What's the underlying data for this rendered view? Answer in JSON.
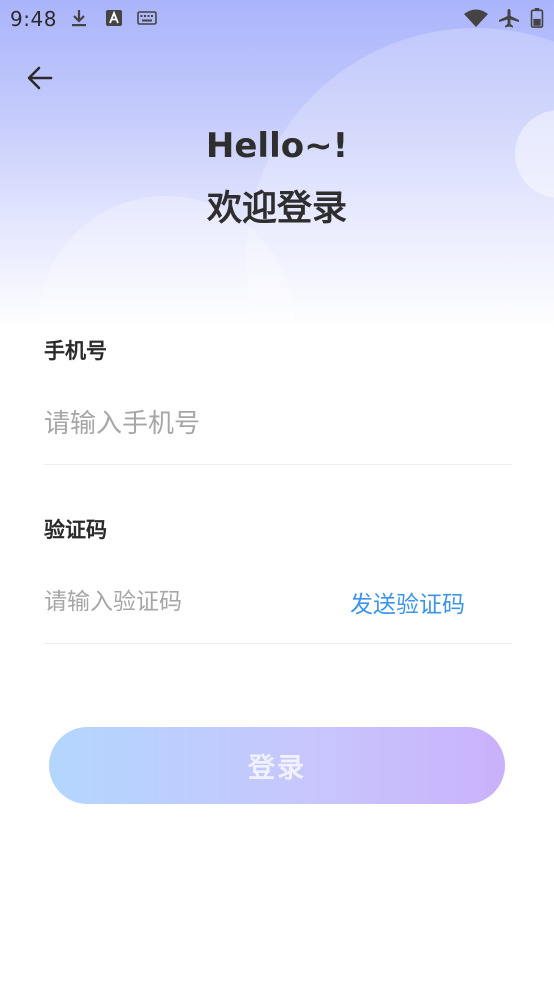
{
  "status_bar": {
    "time": "9:48",
    "icons": [
      "download-icon",
      "a-badge-icon",
      "keyboard-icon",
      "wifi-icon",
      "airplane-icon",
      "battery-icon"
    ]
  },
  "header": {
    "greeting": "Hello~!",
    "title": "欢迎登录"
  },
  "form": {
    "phone_label": "手机号",
    "phone_placeholder": "请输入手机号",
    "code_label": "验证码",
    "code_placeholder": "请输入验证码",
    "send_code_label": "发送验证码"
  },
  "login_button": {
    "label": "登录"
  },
  "colors": {
    "hero_top": "#aab4fb",
    "link": "#3e95e8",
    "button_start": "#b3d6fe",
    "button_end": "#cab1fb"
  }
}
